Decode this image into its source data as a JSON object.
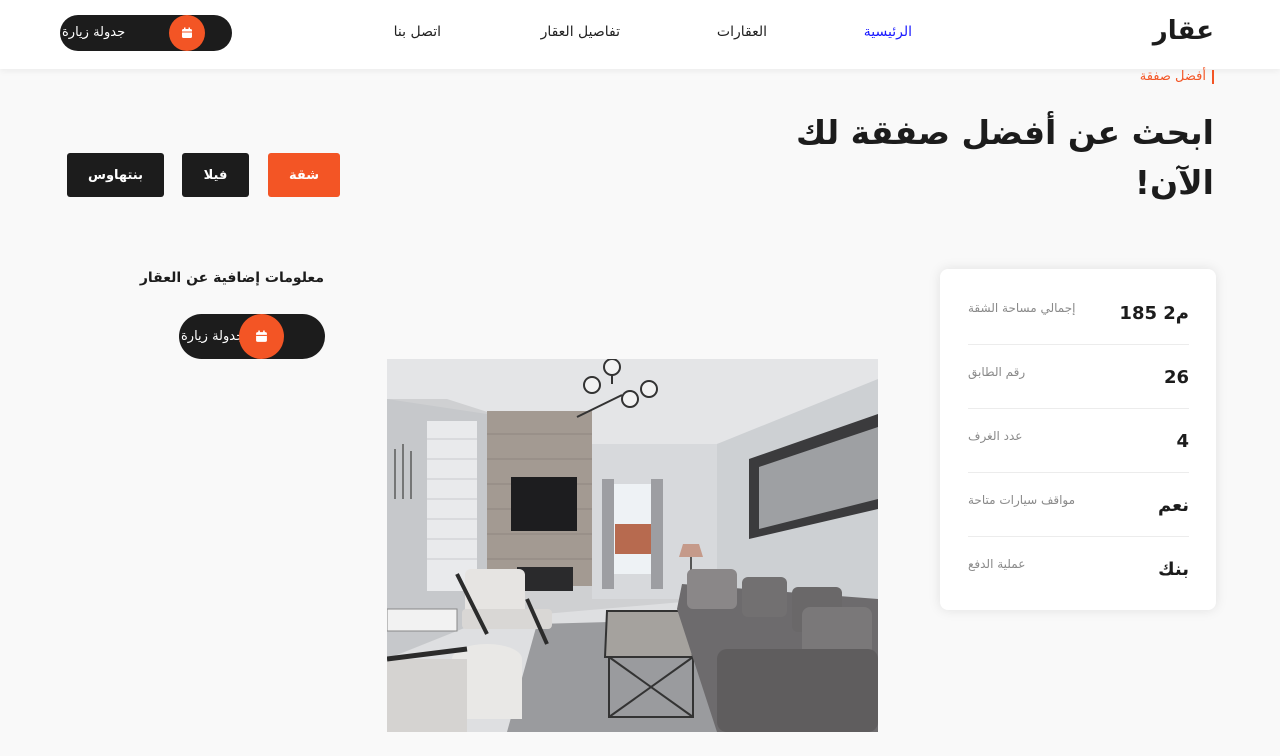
{
  "brand": "عقار",
  "nav": {
    "home": "الرئيسية",
    "properties": "العقارات",
    "details": "تفاصيل العقار",
    "contact": "اتصل بنا"
  },
  "schedule_label": "جدولة زيارة",
  "breadcrumb": "أفضل صفقة",
  "page_title": "ابحث عن أفضل صفقة لك الآن!",
  "filters": [
    "شقة",
    "فيلا",
    "بنتهاوس"
  ],
  "info": [
    {
      "value": "185 م2",
      "label": "إجمالي مساحة الشقة"
    },
    {
      "value": "26",
      "label": "رقم الطابق"
    },
    {
      "value": "4",
      "label": "عدد الغرف"
    },
    {
      "value": "نعم",
      "label": "مواقف سيارات متاحة"
    },
    {
      "value": "بنك",
      "label": "عملية الدفع"
    }
  ],
  "extra_title": "معلومات إضافية عن العقار",
  "colors": {
    "accent": "#f35525",
    "dark": "#1c1c1c",
    "active_link": "#1a1aff"
  },
  "icons": {
    "schedule": "calendar-icon"
  }
}
